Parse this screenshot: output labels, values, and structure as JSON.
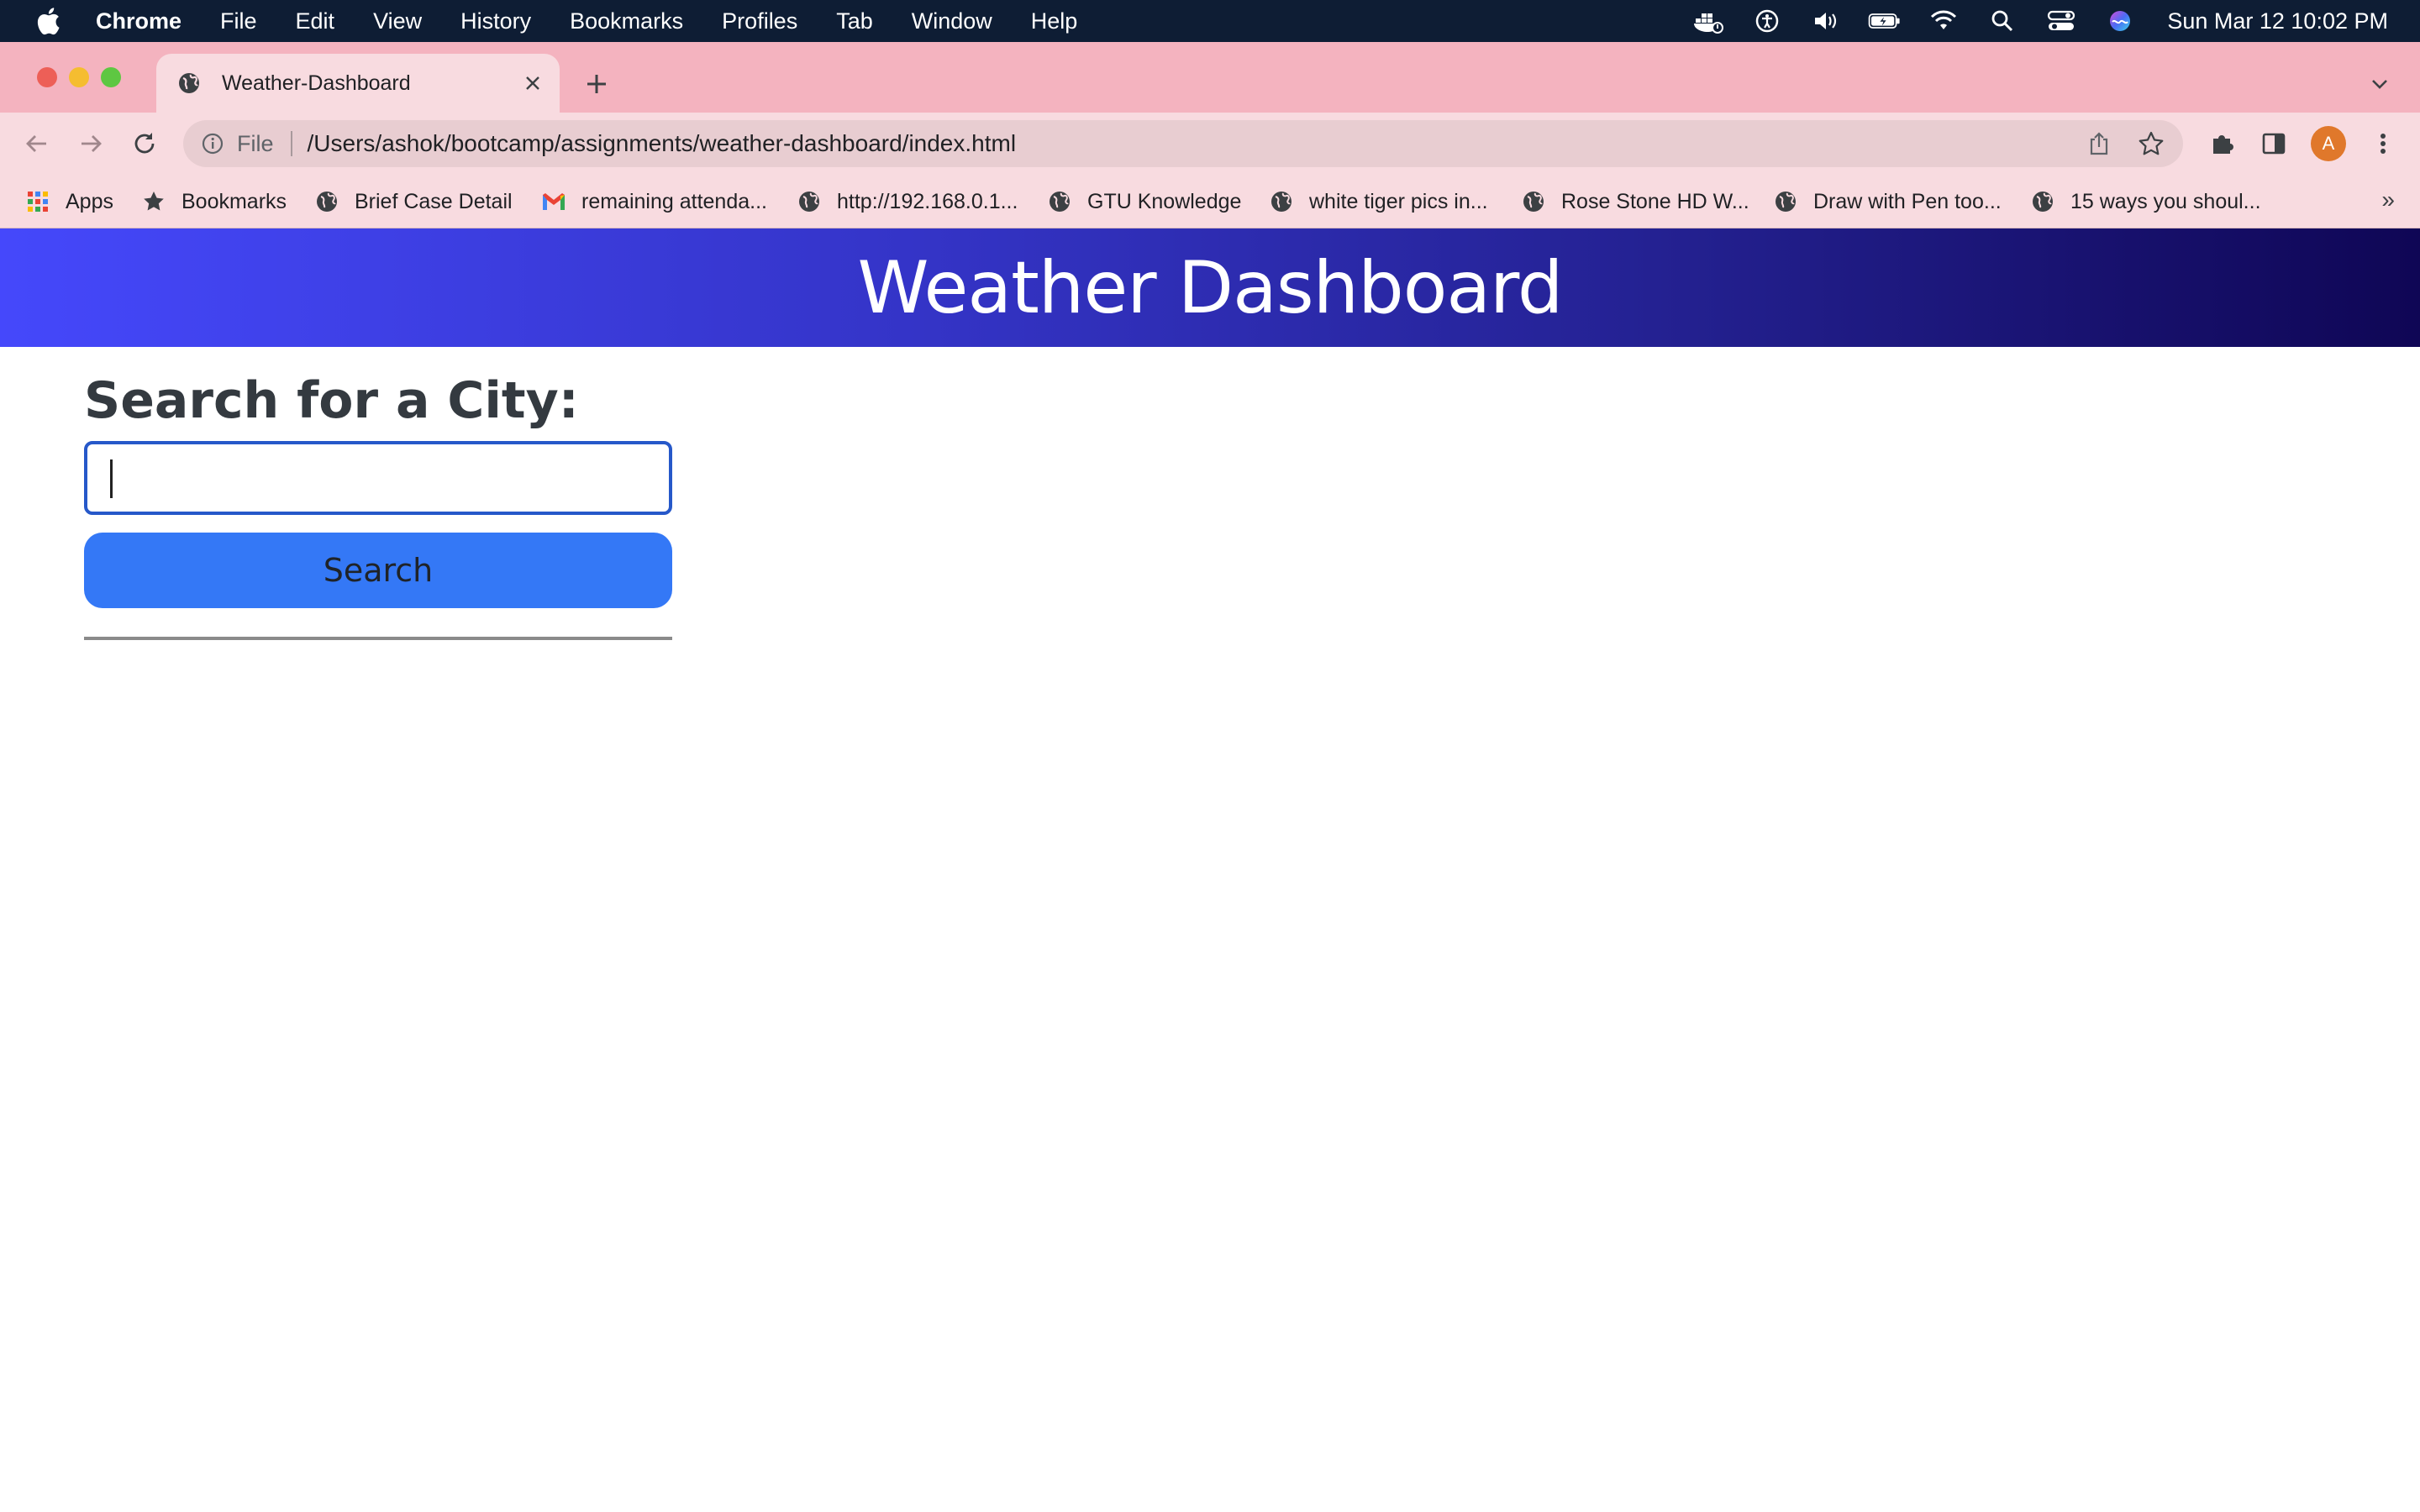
{
  "menubar": {
    "app_name": "Chrome",
    "items": [
      "File",
      "Edit",
      "View",
      "History",
      "Bookmarks",
      "Profiles",
      "Tab",
      "Window",
      "Help"
    ],
    "clock": "Sun Mar 12  10:02 PM",
    "status_icons": [
      "docker-icon",
      "accessibility-icon",
      "volume-icon",
      "battery-icon",
      "wifi-icon",
      "spotlight-search-icon",
      "control-center-icon",
      "siri-icon"
    ]
  },
  "browser": {
    "tab_title": "Weather-Dashboard",
    "scheme_label": "File",
    "url": "/Users/ashok/bootcamp/assignments/weather-dashboard/index.html",
    "avatar_letter": "A",
    "colors": {
      "tabstrip": "#f4b3bf",
      "toolbar": "#f8dbe0",
      "omnibox": "#e8cdd1",
      "avatar": "#e0782b"
    }
  },
  "bookmarks": [
    {
      "label": "Apps",
      "icon": "apps-grid-icon"
    },
    {
      "label": "Bookmarks",
      "icon": "star-icon"
    },
    {
      "label": "Brief Case Detail",
      "icon": "globe-icon"
    },
    {
      "label": "remaining attenda...",
      "icon": "gmail-icon"
    },
    {
      "label": "http://192.168.0.1...",
      "icon": "globe-icon"
    },
    {
      "label": "GTU Knowledge",
      "icon": "globe-icon"
    },
    {
      "label": "white tiger pics in...",
      "icon": "globe-icon"
    },
    {
      "label": "Rose Stone HD W...",
      "icon": "globe-icon"
    },
    {
      "label": "Draw with Pen too...",
      "icon": "globe-icon"
    },
    {
      "label": "15 ways you shoul...",
      "icon": "globe-icon"
    }
  ],
  "bookmarks_overflow": "»",
  "page": {
    "header_title": "Weather Dashboard",
    "search_heading": "Search for a City:",
    "search_input_value": "",
    "search_button_label": "Search",
    "colors": {
      "banner_start": "#4548fb",
      "banner_end": "#0f0655",
      "search_button": "#3478f6",
      "input_border": "#2658c9"
    }
  }
}
